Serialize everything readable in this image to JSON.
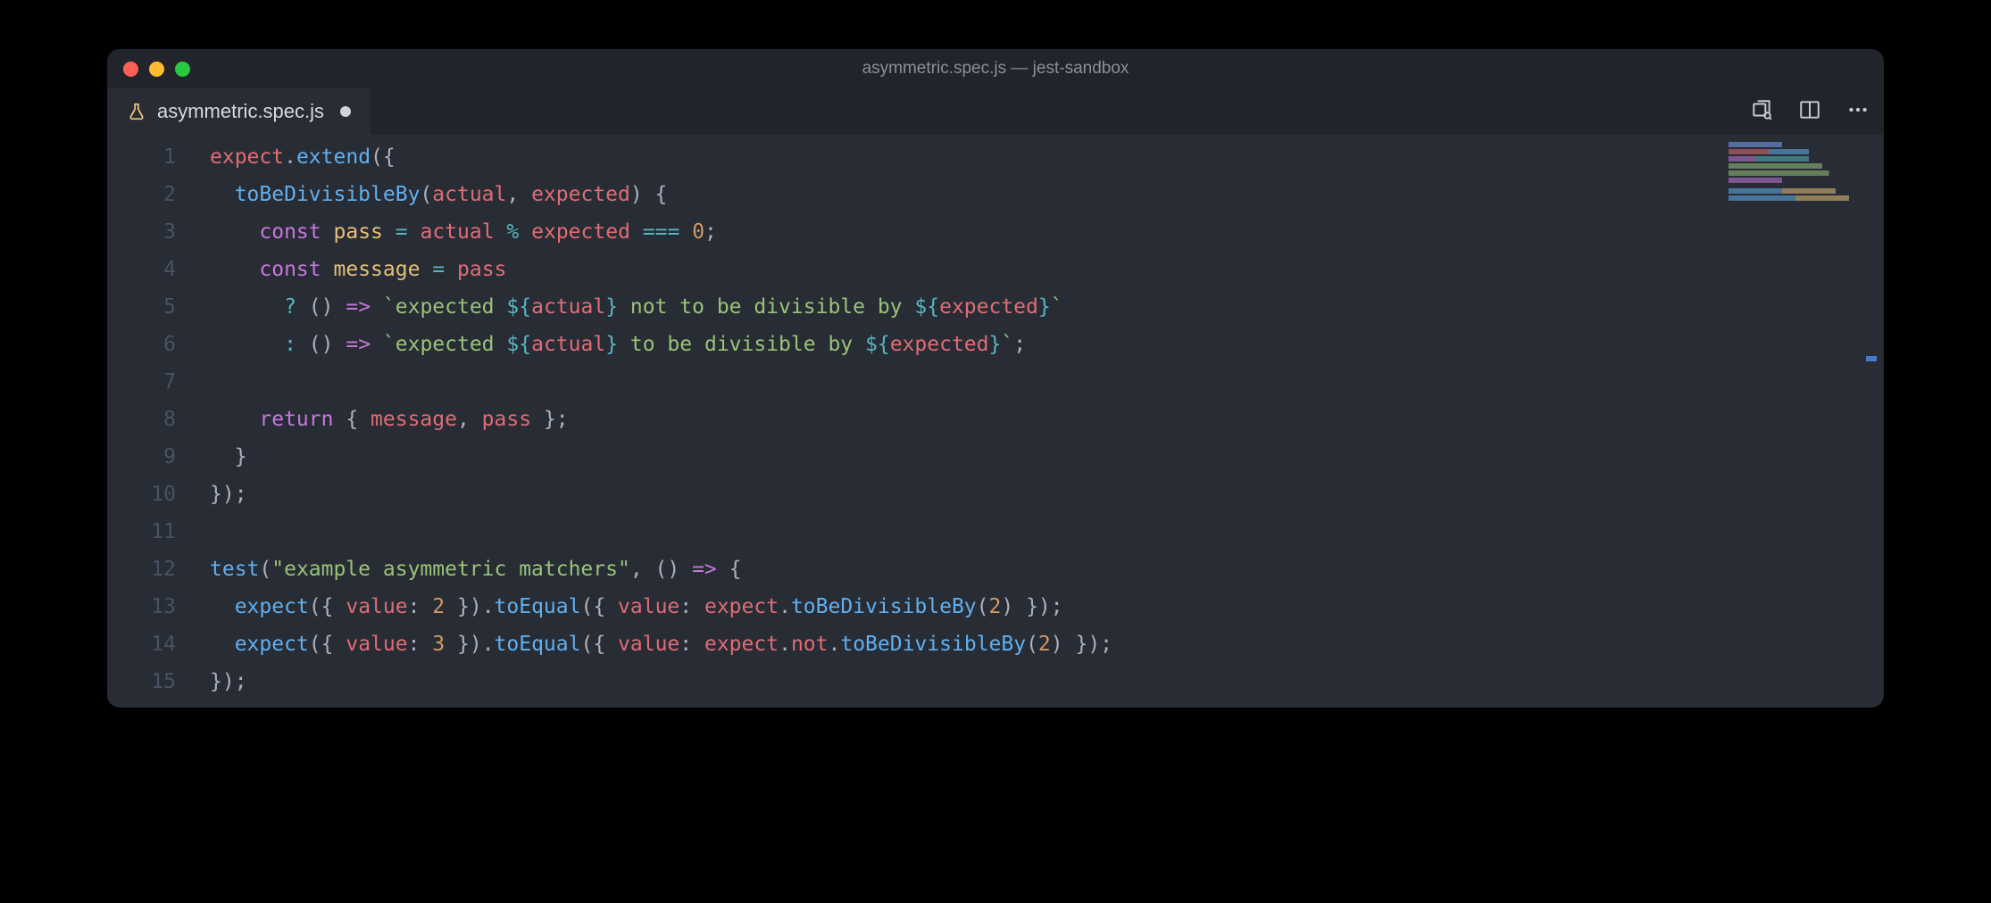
{
  "window": {
    "title": "asymmetric.spec.js — jest-sandbox"
  },
  "tab": {
    "filename": "asymmetric.spec.js",
    "dirty": true
  },
  "editor": {
    "line_numbers": [
      "1",
      "2",
      "3",
      "4",
      "5",
      "6",
      "7",
      "8",
      "9",
      "10",
      "11",
      "12",
      "13",
      "14",
      "15"
    ],
    "lines": [
      [
        {
          "t": "expect",
          "c": "t-red"
        },
        {
          "t": ".",
          "c": "t-white"
        },
        {
          "t": "extend",
          "c": "t-blue"
        },
        {
          "t": "({",
          "c": "t-white"
        }
      ],
      [
        {
          "t": "  ",
          "c": "t-white"
        },
        {
          "t": "toBeDivisibleBy",
          "c": "t-blue"
        },
        {
          "t": "(",
          "c": "t-white"
        },
        {
          "t": "actual",
          "c": "t-red"
        },
        {
          "t": ", ",
          "c": "t-white"
        },
        {
          "t": "expected",
          "c": "t-red"
        },
        {
          "t": ") {",
          "c": "t-white"
        }
      ],
      [
        {
          "t": "    ",
          "c": "t-white"
        },
        {
          "t": "const",
          "c": "t-purple"
        },
        {
          "t": " ",
          "c": "t-white"
        },
        {
          "t": "pass",
          "c": "t-yellow"
        },
        {
          "t": " ",
          "c": "t-white"
        },
        {
          "t": "=",
          "c": "t-cyan"
        },
        {
          "t": " ",
          "c": "t-white"
        },
        {
          "t": "actual",
          "c": "t-red"
        },
        {
          "t": " ",
          "c": "t-white"
        },
        {
          "t": "%",
          "c": "t-cyan"
        },
        {
          "t": " ",
          "c": "t-white"
        },
        {
          "t": "expected",
          "c": "t-red"
        },
        {
          "t": " ",
          "c": "t-white"
        },
        {
          "t": "===",
          "c": "t-cyan"
        },
        {
          "t": " ",
          "c": "t-white"
        },
        {
          "t": "0",
          "c": "t-orange"
        },
        {
          "t": ";",
          "c": "t-white"
        }
      ],
      [
        {
          "t": "    ",
          "c": "t-white"
        },
        {
          "t": "const",
          "c": "t-purple"
        },
        {
          "t": " ",
          "c": "t-white"
        },
        {
          "t": "message",
          "c": "t-yellow"
        },
        {
          "t": " ",
          "c": "t-white"
        },
        {
          "t": "=",
          "c": "t-cyan"
        },
        {
          "t": " ",
          "c": "t-white"
        },
        {
          "t": "pass",
          "c": "t-red"
        }
      ],
      [
        {
          "t": "      ",
          "c": "t-white"
        },
        {
          "t": "?",
          "c": "t-cyan"
        },
        {
          "t": " () ",
          "c": "t-white"
        },
        {
          "t": "=>",
          "c": "t-purple"
        },
        {
          "t": " ",
          "c": "t-white"
        },
        {
          "t": "`expected ",
          "c": "t-green"
        },
        {
          "t": "${",
          "c": "t-cyan"
        },
        {
          "t": "actual",
          "c": "t-red"
        },
        {
          "t": "}",
          "c": "t-cyan"
        },
        {
          "t": " not to be divisible by ",
          "c": "t-green"
        },
        {
          "t": "${",
          "c": "t-cyan"
        },
        {
          "t": "expected",
          "c": "t-red"
        },
        {
          "t": "}",
          "c": "t-cyan"
        },
        {
          "t": "`",
          "c": "t-green"
        }
      ],
      [
        {
          "t": "      ",
          "c": "t-white"
        },
        {
          "t": ":",
          "c": "t-cyan"
        },
        {
          "t": " () ",
          "c": "t-white"
        },
        {
          "t": "=>",
          "c": "t-purple"
        },
        {
          "t": " ",
          "c": "t-white"
        },
        {
          "t": "`expected ",
          "c": "t-green"
        },
        {
          "t": "${",
          "c": "t-cyan"
        },
        {
          "t": "actual",
          "c": "t-red"
        },
        {
          "t": "}",
          "c": "t-cyan"
        },
        {
          "t": " to be divisible by ",
          "c": "t-green"
        },
        {
          "t": "${",
          "c": "t-cyan"
        },
        {
          "t": "expected",
          "c": "t-red"
        },
        {
          "t": "}",
          "c": "t-cyan"
        },
        {
          "t": "`",
          "c": "t-green"
        },
        {
          "t": ";",
          "c": "t-white"
        }
      ],
      [
        {
          "t": "",
          "c": "t-white"
        }
      ],
      [
        {
          "t": "    ",
          "c": "t-white"
        },
        {
          "t": "return",
          "c": "t-purple"
        },
        {
          "t": " { ",
          "c": "t-white"
        },
        {
          "t": "message",
          "c": "t-red"
        },
        {
          "t": ", ",
          "c": "t-white"
        },
        {
          "t": "pass",
          "c": "t-red"
        },
        {
          "t": " };",
          "c": "t-white"
        }
      ],
      [
        {
          "t": "  }",
          "c": "t-white"
        }
      ],
      [
        {
          "t": "});",
          "c": "t-white"
        }
      ],
      [
        {
          "t": "",
          "c": "t-white"
        }
      ],
      [
        {
          "t": "test",
          "c": "t-blue"
        },
        {
          "t": "(",
          "c": "t-white"
        },
        {
          "t": "\"example asymmetric matchers\"",
          "c": "t-green"
        },
        {
          "t": ", () ",
          "c": "t-white"
        },
        {
          "t": "=>",
          "c": "t-purple"
        },
        {
          "t": " {",
          "c": "t-white"
        }
      ],
      [
        {
          "t": "  ",
          "c": "t-white"
        },
        {
          "t": "expect",
          "c": "t-blue"
        },
        {
          "t": "({ ",
          "c": "t-white"
        },
        {
          "t": "value",
          "c": "t-red"
        },
        {
          "t": ": ",
          "c": "t-white"
        },
        {
          "t": "2",
          "c": "t-orange"
        },
        {
          "t": " }).",
          "c": "t-white"
        },
        {
          "t": "toEqual",
          "c": "t-blue"
        },
        {
          "t": "({ ",
          "c": "t-white"
        },
        {
          "t": "value",
          "c": "t-red"
        },
        {
          "t": ": ",
          "c": "t-white"
        },
        {
          "t": "expect",
          "c": "t-red"
        },
        {
          "t": ".",
          "c": "t-white"
        },
        {
          "t": "toBeDivisibleBy",
          "c": "t-blue"
        },
        {
          "t": "(",
          "c": "t-white"
        },
        {
          "t": "2",
          "c": "t-orange"
        },
        {
          "t": ") });",
          "c": "t-white"
        }
      ],
      [
        {
          "t": "  ",
          "c": "t-white"
        },
        {
          "t": "expect",
          "c": "t-blue"
        },
        {
          "t": "({ ",
          "c": "t-white"
        },
        {
          "t": "value",
          "c": "t-red"
        },
        {
          "t": ": ",
          "c": "t-white"
        },
        {
          "t": "3",
          "c": "t-orange"
        },
        {
          "t": " }).",
          "c": "t-white"
        },
        {
          "t": "toEqual",
          "c": "t-blue"
        },
        {
          "t": "({ ",
          "c": "t-white"
        },
        {
          "t": "value",
          "c": "t-red"
        },
        {
          "t": ": ",
          "c": "t-white"
        },
        {
          "t": "expect",
          "c": "t-red"
        },
        {
          "t": ".",
          "c": "t-white"
        },
        {
          "t": "not",
          "c": "t-red"
        },
        {
          "t": ".",
          "c": "t-white"
        },
        {
          "t": "toBeDivisibleBy",
          "c": "t-blue"
        },
        {
          "t": "(",
          "c": "t-white"
        },
        {
          "t": "2",
          "c": "t-orange"
        },
        {
          "t": ") });",
          "c": "t-white"
        }
      ],
      [
        {
          "t": "});",
          "c": "t-white"
        }
      ]
    ]
  }
}
